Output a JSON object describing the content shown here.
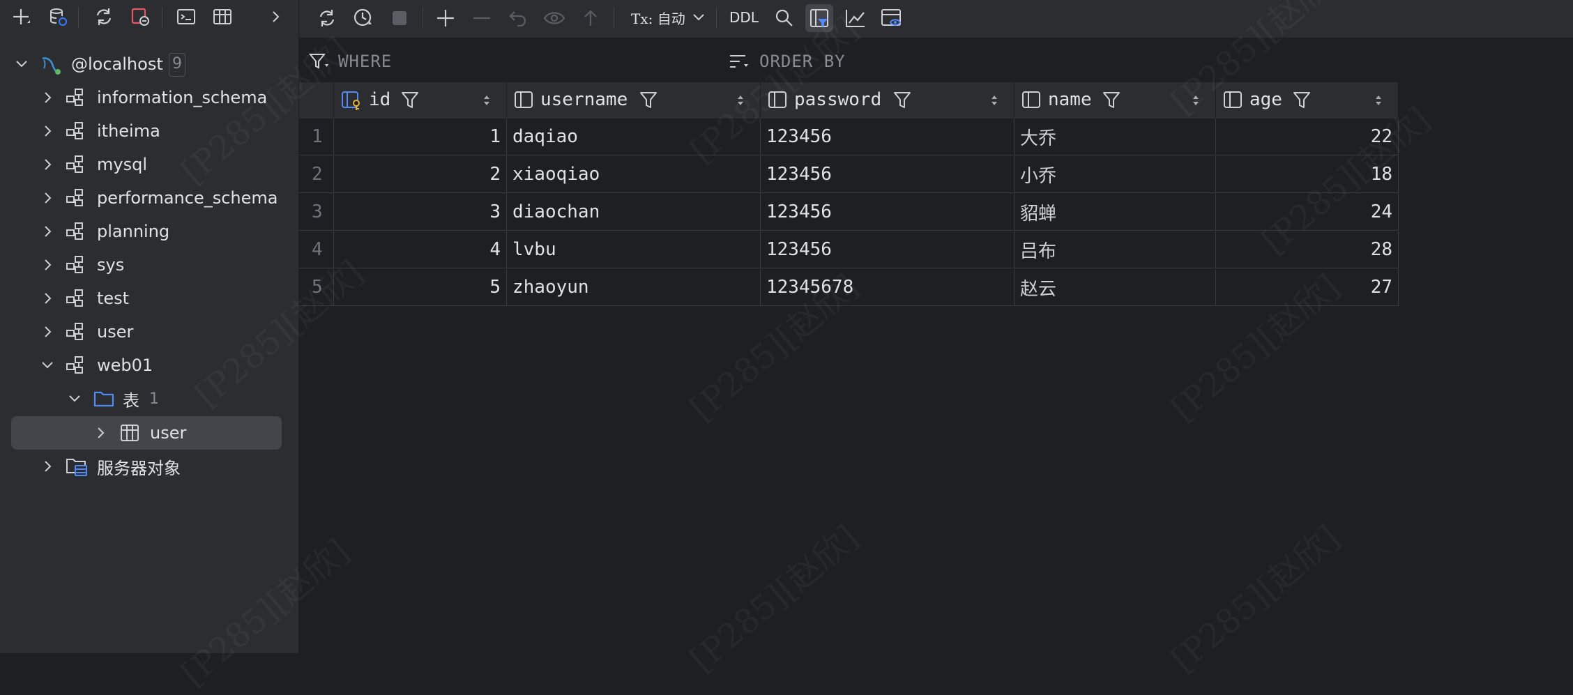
{
  "sidebar": {
    "root": {
      "label": "@localhost",
      "count": "9"
    },
    "databases": [
      {
        "label": "information_schema",
        "expanded": false
      },
      {
        "label": "itheima",
        "expanded": false
      },
      {
        "label": "mysql",
        "expanded": false
      },
      {
        "label": "performance_schema",
        "expanded": false
      },
      {
        "label": "planning",
        "expanded": false
      },
      {
        "label": "sys",
        "expanded": false
      },
      {
        "label": "test",
        "expanded": false
      },
      {
        "label": "user",
        "expanded": false
      },
      {
        "label": "web01",
        "expanded": true
      }
    ],
    "tables_folder": {
      "label": "表",
      "count": "1"
    },
    "selected_table": {
      "label": "user"
    },
    "server_objects": {
      "label": "服务器对象"
    }
  },
  "toolbar": {
    "tx_label": "Tx: 自动",
    "ddl_label": "DDL"
  },
  "filter": {
    "where_label": "WHERE",
    "orderby_label": "ORDER BY"
  },
  "grid": {
    "columns": [
      "id",
      "username",
      "password",
      "name",
      "age"
    ],
    "rows": [
      {
        "rownum": "1",
        "id": "1",
        "username": "daqiao",
        "password": "123456",
        "name": "大乔",
        "age": "22"
      },
      {
        "rownum": "2",
        "id": "2",
        "username": "xiaoqiao",
        "password": "123456",
        "name": "小乔",
        "age": "18"
      },
      {
        "rownum": "3",
        "id": "3",
        "username": "diaochan",
        "password": "123456",
        "name": "貂蝉",
        "age": "24"
      },
      {
        "rownum": "4",
        "id": "4",
        "username": "lvbu",
        "password": "123456",
        "name": "吕布",
        "age": "28"
      },
      {
        "rownum": "5",
        "id": "5",
        "username": "zhaoyun",
        "password": "12345678",
        "name": "赵云",
        "age": "27"
      }
    ]
  },
  "watermark": "[P285][赵欣]",
  "colors": {
    "accent": "#3574f0",
    "green_dot": "#5fb865"
  }
}
